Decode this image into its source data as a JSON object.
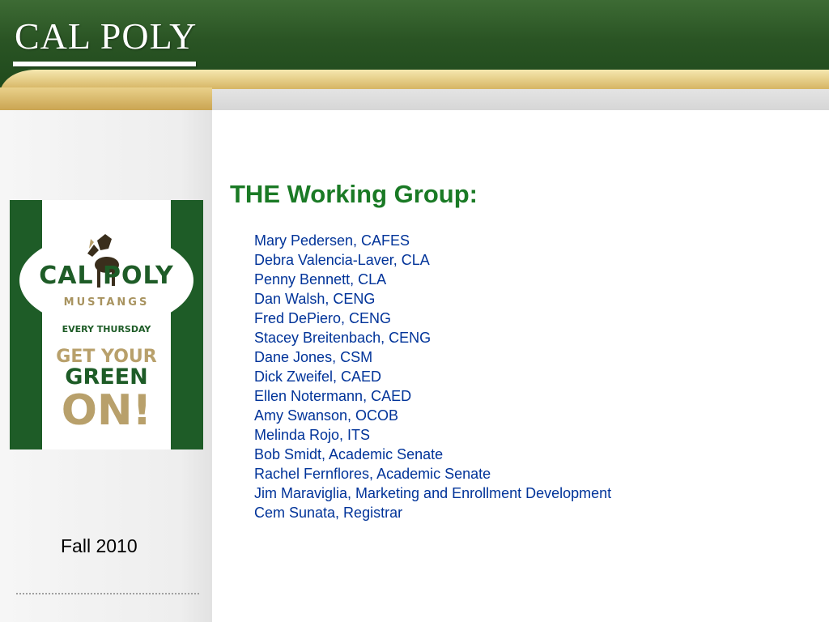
{
  "header": {
    "logo_text": "CAL POLY"
  },
  "poster": {
    "brand": "CAL POLY",
    "subbrand": "MUSTANGS",
    "line1": "EVERY THURSDAY",
    "line2": "GET YOUR",
    "line3": "GREEN",
    "line4": "ON!",
    "colors": {
      "green": "#1e5c27",
      "gold": "#b8a06b"
    }
  },
  "footer": {
    "date": "Fall 2010"
  },
  "main": {
    "title": "THE Working Group:",
    "members": [
      "Mary Pedersen, CAFES",
      "Debra Valencia-Laver, CLA",
      "Penny Bennett, CLA",
      "Dan Walsh, CENG",
      "Fred DePiero, CENG",
      "Stacey Breitenbach, CENG",
      "Dane Jones, CSM",
      "Dick Zweifel, CAED",
      "Ellen Notermann, CAED",
      "Amy Swanson, OCOB",
      "Melinda Rojo, ITS",
      "Bob Smidt, Academic Senate",
      "Rachel Fernflores, Academic Senate",
      "Jim Maraviglia, Marketing and Enrollment Development",
      "Cem Sunata, Registrar"
    ]
  },
  "colors": {
    "title": "#1a7a25",
    "members": "#003399",
    "header_green": "#2a5424",
    "header_gold": "#c9a24c"
  }
}
